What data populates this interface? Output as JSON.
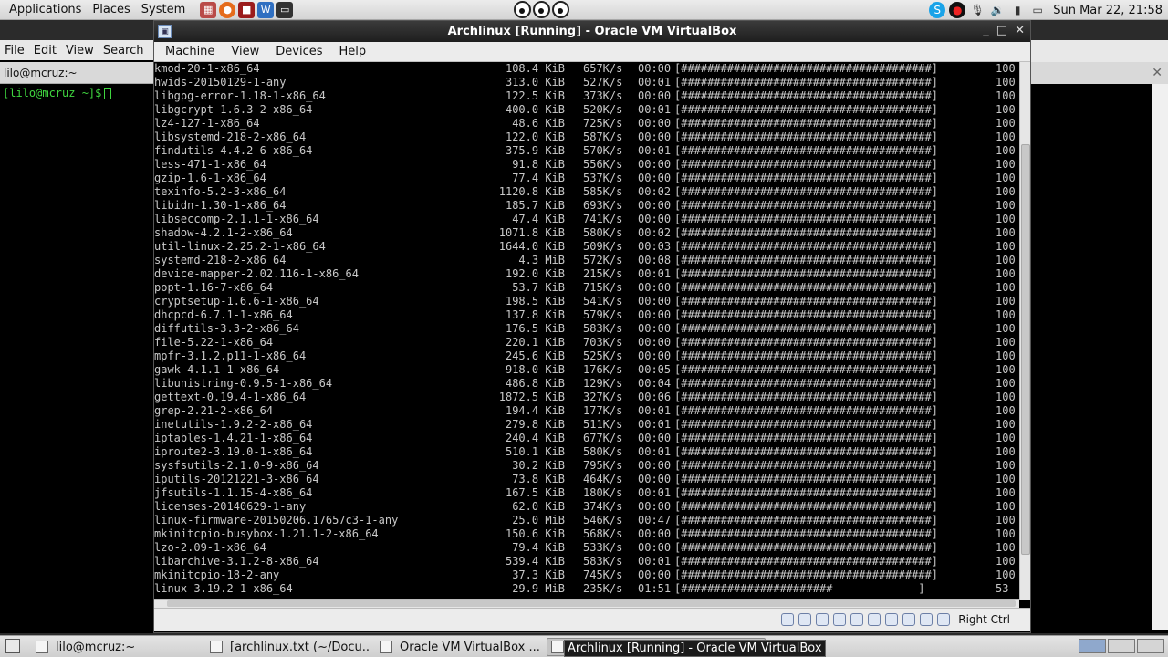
{
  "top_panel": {
    "menus": [
      "Applications",
      "Places",
      "System"
    ],
    "clock": "Sun Mar 22, 21:58"
  },
  "left_terminal": {
    "menus": [
      "File",
      "Edit",
      "View",
      "Search"
    ],
    "tab_title": "lilo@mcruz:~",
    "prompt": "[lilo@mcruz ~]$"
  },
  "vbox": {
    "title": "Archlinux [Running] - Oracle VM VirtualBox",
    "menus": [
      "Machine",
      "View",
      "Devices",
      "Help"
    ],
    "host_key": "Right Ctrl",
    "downloads": [
      {
        "name": "kmod-20-1-x86_64",
        "size": "108.4 KiB",
        "speed": "657K/s",
        "time": "00:00",
        "bar": "[######################################]",
        "pct": "100"
      },
      {
        "name": "hwids-20150129-1-any",
        "size": "313.0 KiB",
        "speed": "527K/s",
        "time": "00:01",
        "bar": "[######################################]",
        "pct": "100"
      },
      {
        "name": "libgpg-error-1.18-1-x86_64",
        "size": "122.5 KiB",
        "speed": "373K/s",
        "time": "00:00",
        "bar": "[######################################]",
        "pct": "100"
      },
      {
        "name": "libgcrypt-1.6.3-2-x86_64",
        "size": "400.0 KiB",
        "speed": "520K/s",
        "time": "00:01",
        "bar": "[######################################]",
        "pct": "100"
      },
      {
        "name": "lz4-127-1-x86_64",
        "size": "48.6 KiB",
        "speed": "725K/s",
        "time": "00:00",
        "bar": "[######################################]",
        "pct": "100"
      },
      {
        "name": "libsystemd-218-2-x86_64",
        "size": "122.0 KiB",
        "speed": "587K/s",
        "time": "00:00",
        "bar": "[######################################]",
        "pct": "100"
      },
      {
        "name": "findutils-4.4.2-6-x86_64",
        "size": "375.9 KiB",
        "speed": "570K/s",
        "time": "00:01",
        "bar": "[######################################]",
        "pct": "100"
      },
      {
        "name": "less-471-1-x86_64",
        "size": "91.8 KiB",
        "speed": "556K/s",
        "time": "00:00",
        "bar": "[######################################]",
        "pct": "100"
      },
      {
        "name": "gzip-1.6-1-x86_64",
        "size": "77.4 KiB",
        "speed": "537K/s",
        "time": "00:00",
        "bar": "[######################################]",
        "pct": "100"
      },
      {
        "name": "texinfo-5.2-3-x86_64",
        "size": "1120.8 KiB",
        "speed": "585K/s",
        "time": "00:02",
        "bar": "[######################################]",
        "pct": "100"
      },
      {
        "name": "libidn-1.30-1-x86_64",
        "size": "185.7 KiB",
        "speed": "693K/s",
        "time": "00:00",
        "bar": "[######################################]",
        "pct": "100"
      },
      {
        "name": "libseccomp-2.1.1-1-x86_64",
        "size": "47.4 KiB",
        "speed": "741K/s",
        "time": "00:00",
        "bar": "[######################################]",
        "pct": "100"
      },
      {
        "name": "shadow-4.2.1-2-x86_64",
        "size": "1071.8 KiB",
        "speed": "580K/s",
        "time": "00:02",
        "bar": "[######################################]",
        "pct": "100"
      },
      {
        "name": "util-linux-2.25.2-1-x86_64",
        "size": "1644.0 KiB",
        "speed": "509K/s",
        "time": "00:03",
        "bar": "[######################################]",
        "pct": "100"
      },
      {
        "name": "systemd-218-2-x86_64",
        "size": "4.3 MiB",
        "speed": "572K/s",
        "time": "00:08",
        "bar": "[######################################]",
        "pct": "100"
      },
      {
        "name": "device-mapper-2.02.116-1-x86_64",
        "size": "192.0 KiB",
        "speed": "215K/s",
        "time": "00:01",
        "bar": "[######################################]",
        "pct": "100"
      },
      {
        "name": "popt-1.16-7-x86_64",
        "size": "53.7 KiB",
        "speed": "715K/s",
        "time": "00:00",
        "bar": "[######################################]",
        "pct": "100"
      },
      {
        "name": "cryptsetup-1.6.6-1-x86_64",
        "size": "198.5 KiB",
        "speed": "541K/s",
        "time": "00:00",
        "bar": "[######################################]",
        "pct": "100"
      },
      {
        "name": "dhcpcd-6.7.1-1-x86_64",
        "size": "137.8 KiB",
        "speed": "579K/s",
        "time": "00:00",
        "bar": "[######################################]",
        "pct": "100"
      },
      {
        "name": "diffutils-3.3-2-x86_64",
        "size": "176.5 KiB",
        "speed": "583K/s",
        "time": "00:00",
        "bar": "[######################################]",
        "pct": "100"
      },
      {
        "name": "file-5.22-1-x86_64",
        "size": "220.1 KiB",
        "speed": "703K/s",
        "time": "00:00",
        "bar": "[######################################]",
        "pct": "100"
      },
      {
        "name": "mpfr-3.1.2.p11-1-x86_64",
        "size": "245.6 KiB",
        "speed": "525K/s",
        "time": "00:00",
        "bar": "[######################################]",
        "pct": "100"
      },
      {
        "name": "gawk-4.1.1-1-x86_64",
        "size": "918.0 KiB",
        "speed": "176K/s",
        "time": "00:05",
        "bar": "[######################################]",
        "pct": "100"
      },
      {
        "name": "libunistring-0.9.5-1-x86_64",
        "size": "486.8 KiB",
        "speed": "129K/s",
        "time": "00:04",
        "bar": "[######################################]",
        "pct": "100"
      },
      {
        "name": "gettext-0.19.4-1-x86_64",
        "size": "1872.5 KiB",
        "speed": "327K/s",
        "time": "00:06",
        "bar": "[######################################]",
        "pct": "100"
      },
      {
        "name": "grep-2.21-2-x86_64",
        "size": "194.4 KiB",
        "speed": "177K/s",
        "time": "00:01",
        "bar": "[######################################]",
        "pct": "100"
      },
      {
        "name": "inetutils-1.9.2-2-x86_64",
        "size": "279.8 KiB",
        "speed": "511K/s",
        "time": "00:01",
        "bar": "[######################################]",
        "pct": "100"
      },
      {
        "name": "iptables-1.4.21-1-x86_64",
        "size": "240.4 KiB",
        "speed": "677K/s",
        "time": "00:00",
        "bar": "[######################################]",
        "pct": "100"
      },
      {
        "name": "iproute2-3.19.0-1-x86_64",
        "size": "510.1 KiB",
        "speed": "580K/s",
        "time": "00:01",
        "bar": "[######################################]",
        "pct": "100"
      },
      {
        "name": "sysfsutils-2.1.0-9-x86_64",
        "size": "30.2 KiB",
        "speed": "795K/s",
        "time": "00:00",
        "bar": "[######################################]",
        "pct": "100"
      },
      {
        "name": "iputils-20121221-3-x86_64",
        "size": "73.8 KiB",
        "speed": "464K/s",
        "time": "00:00",
        "bar": "[######################################]",
        "pct": "100"
      },
      {
        "name": "jfsutils-1.1.15-4-x86_64",
        "size": "167.5 KiB",
        "speed": "180K/s",
        "time": "00:01",
        "bar": "[######################################]",
        "pct": "100"
      },
      {
        "name": "licenses-20140629-1-any",
        "size": "62.0 KiB",
        "speed": "374K/s",
        "time": "00:00",
        "bar": "[######################################]",
        "pct": "100"
      },
      {
        "name": "linux-firmware-20150206.17657c3-1-any",
        "size": "25.0 MiB",
        "speed": "546K/s",
        "time": "00:47",
        "bar": "[######################################]",
        "pct": "100"
      },
      {
        "name": "mkinitcpio-busybox-1.21.1-2-x86_64",
        "size": "150.6 KiB",
        "speed": "568K/s",
        "time": "00:00",
        "bar": "[######################################]",
        "pct": "100"
      },
      {
        "name": "lzo-2.09-1-x86_64",
        "size": "79.4 KiB",
        "speed": "533K/s",
        "time": "00:00",
        "bar": "[######################################]",
        "pct": "100"
      },
      {
        "name": "libarchive-3.1.2-8-x86_64",
        "size": "539.4 KiB",
        "speed": "583K/s",
        "time": "00:01",
        "bar": "[######################################]",
        "pct": "100"
      },
      {
        "name": "mkinitcpio-18-2-any",
        "size": "37.3 KiB",
        "speed": "745K/s",
        "time": "00:00",
        "bar": "[######################################]",
        "pct": "100"
      },
      {
        "name": "linux-3.19.2-1-x86_64",
        "size": "29.9 MiB",
        "speed": "235K/s",
        "time": "01:51",
        "bar": "[#######################-------------]",
        "pct": "53"
      }
    ]
  },
  "taskbar": {
    "tasks": [
      {
        "label": "lilo@mcruz:~"
      },
      {
        "label": "[archlinux.txt (~/Docu..."
      },
      {
        "label": "Oracle VM VirtualBox ..."
      },
      {
        "label": ""
      }
    ],
    "tooltip": "Archlinux [Running] - Oracle VM VirtualBox"
  },
  "colors": {
    "terminal_bg": "#000000",
    "terminal_fg": "#c8c8c8",
    "prompt_green": "#3fd53f",
    "title_bar": "#1e1e1e"
  }
}
